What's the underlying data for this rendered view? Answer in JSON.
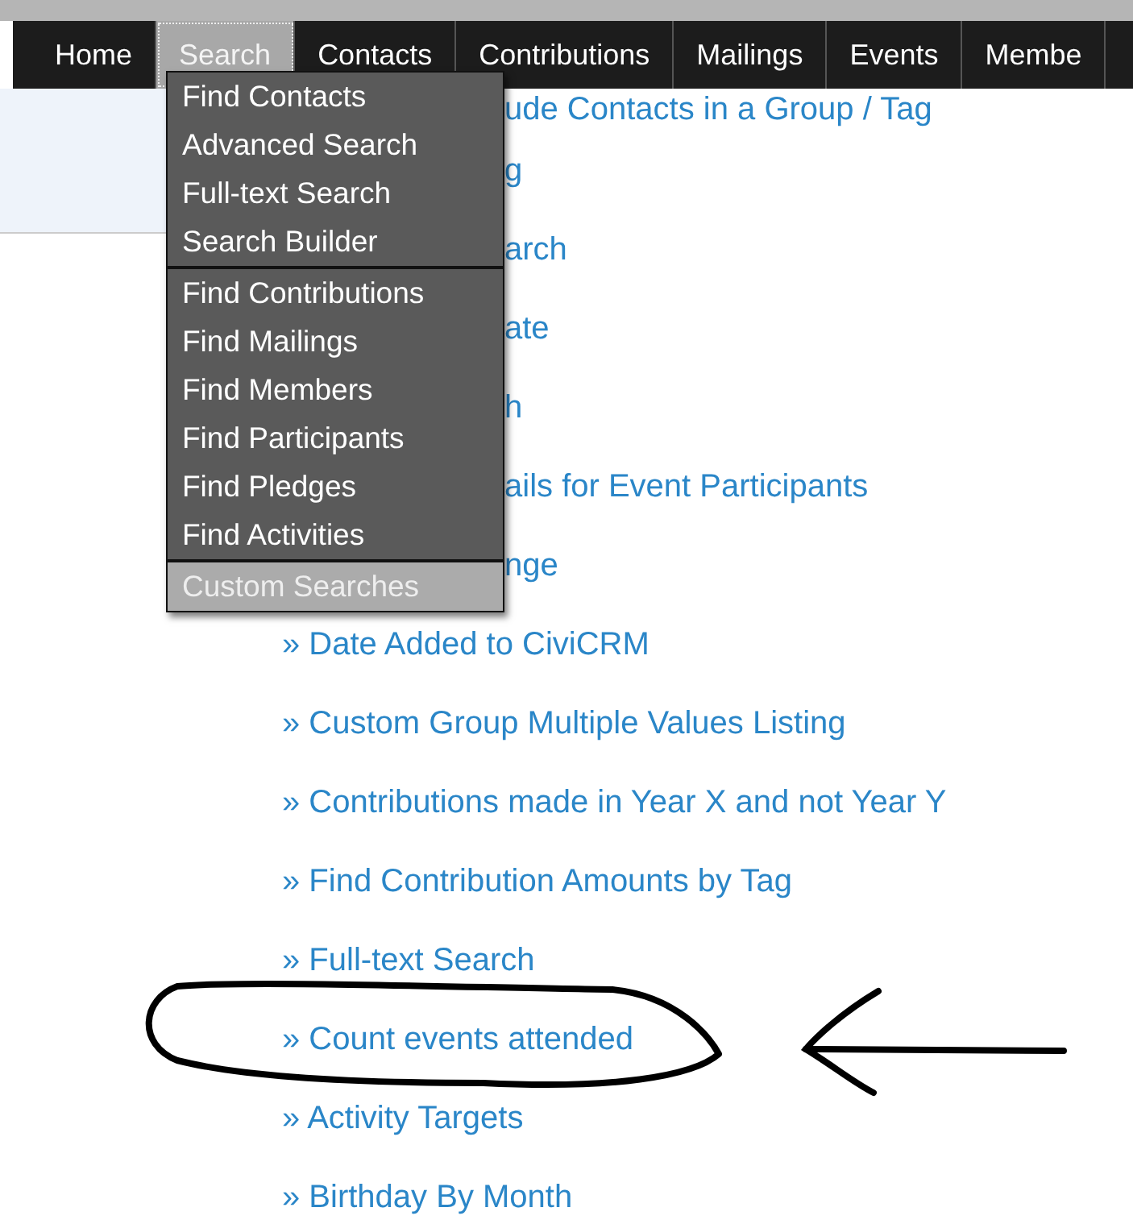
{
  "nav_tabs": [
    {
      "label": "Home",
      "selected": false
    },
    {
      "label": "Search",
      "selected": true
    },
    {
      "label": "Contacts",
      "selected": false
    },
    {
      "label": "Contributions",
      "selected": false
    },
    {
      "label": "Mailings",
      "selected": false
    },
    {
      "label": "Events",
      "selected": false
    },
    {
      "label": "Membe",
      "selected": false
    }
  ],
  "search_menu": {
    "groups": [
      {
        "items": [
          {
            "label": "Find Contacts",
            "selected": false
          },
          {
            "label": "Advanced Search",
            "selected": false
          },
          {
            "label": "Full-text Search",
            "selected": false
          },
          {
            "label": "Search Builder",
            "selected": false
          }
        ]
      },
      {
        "items": [
          {
            "label": "Find Contributions",
            "selected": false
          },
          {
            "label": "Find Mailings",
            "selected": false
          },
          {
            "label": "Find Members",
            "selected": false
          },
          {
            "label": "Find Participants",
            "selected": false
          },
          {
            "label": "Find Pledges",
            "selected": false
          },
          {
            "label": "Find Activities",
            "selected": false
          }
        ]
      },
      {
        "items": [
          {
            "label": "Custom Searches",
            "selected": true
          }
        ]
      }
    ]
  },
  "custom_searches": [
    {
      "kind": "partial",
      "label": "ude Contacts in a Group / Tag"
    },
    {
      "kind": "partial",
      "label": "g"
    },
    {
      "kind": "partial",
      "label": "arch"
    },
    {
      "kind": "partial",
      "label": "ate"
    },
    {
      "kind": "partial",
      "label": "h"
    },
    {
      "kind": "partial",
      "label": "ails for Event Participants"
    },
    {
      "kind": "partial",
      "label": "nge"
    },
    {
      "kind": "full",
      "label": "» Date Added to CiviCRM"
    },
    {
      "kind": "full",
      "label": "» Custom Group Multiple Values Listing"
    },
    {
      "kind": "full",
      "label": "» Contributions made in Year X and not Year Y"
    },
    {
      "kind": "full",
      "label": "» Find Contribution Amounts by Tag"
    },
    {
      "kind": "full",
      "label": "» Full-text Search"
    },
    {
      "kind": "full",
      "label": "» Count events attended"
    },
    {
      "kind": "full",
      "label": "» Activity Targets"
    },
    {
      "kind": "full",
      "label": "» Birthday By Month"
    }
  ]
}
